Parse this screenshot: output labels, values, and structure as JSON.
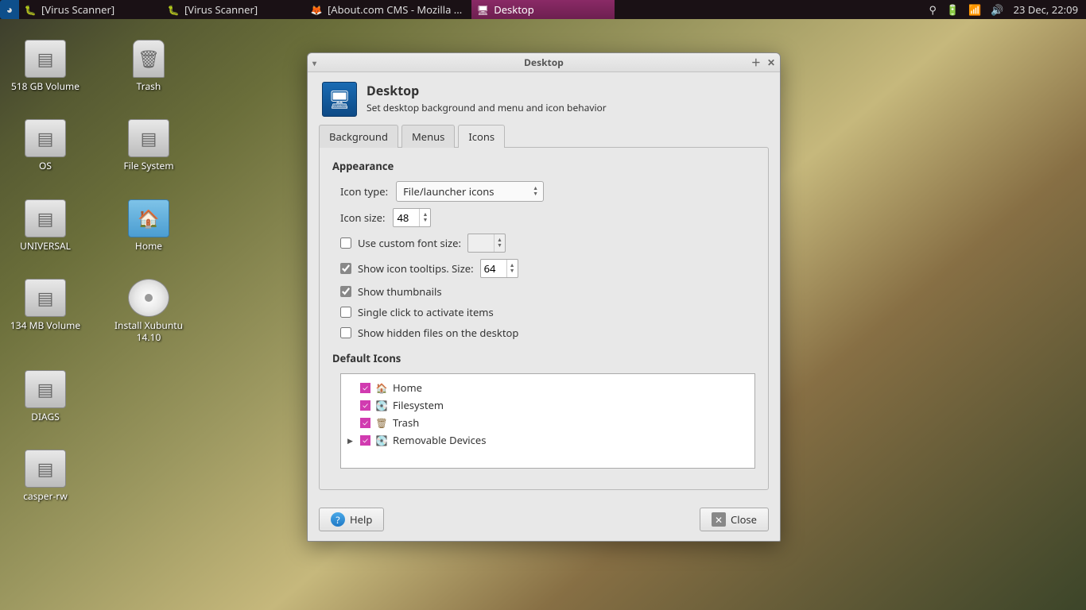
{
  "panel": {
    "tasks": [
      {
        "label": "[Virus Scanner]",
        "icon": "🐛"
      },
      {
        "label": "[Virus Scanner]",
        "icon": "🐛"
      },
      {
        "label": "[About.com CMS - Mozilla ...",
        "icon": "🦊"
      },
      {
        "label": "Desktop",
        "icon": "🖥",
        "active": true
      }
    ],
    "clock": "23 Dec, 22:09"
  },
  "desktop_icons": [
    [
      {
        "label": "518 GB Volume",
        "kind": "drive"
      },
      {
        "label": "Trash",
        "kind": "trash"
      }
    ],
    [
      {
        "label": "OS",
        "kind": "drive"
      },
      {
        "label": "File System",
        "kind": "drive"
      }
    ],
    [
      {
        "label": "UNIVERSAL",
        "kind": "drive"
      },
      {
        "label": "Home",
        "kind": "folder"
      }
    ],
    [
      {
        "label": "134 MB Volume",
        "kind": "drive"
      },
      {
        "label": "Install Xubuntu 14.10",
        "kind": "cd"
      }
    ],
    [
      {
        "label": "DIAGS",
        "kind": "drive"
      }
    ],
    [
      {
        "label": "casper-rw",
        "kind": "drive"
      }
    ]
  ],
  "window": {
    "title": "Desktop",
    "header_title": "Desktop",
    "header_subtitle": "Set desktop background and menu and icon behavior",
    "tabs": {
      "background": "Background",
      "menus": "Menus",
      "icons": "Icons"
    },
    "appearance": {
      "title": "Appearance",
      "icon_type_label": "Icon type:",
      "icon_type_value": "File/launcher icons",
      "icon_size_label": "Icon size:",
      "icon_size_value": "48",
      "custom_font_label": "Use custom font size:",
      "custom_font_checked": false,
      "custom_font_value": "",
      "tooltips_label": "Show icon tooltips. Size:",
      "tooltips_checked": true,
      "tooltips_value": "64",
      "thumbnails_label": "Show thumbnails",
      "thumbnails_checked": true,
      "singleclick_label": "Single click to activate items",
      "singleclick_checked": false,
      "hidden_label": "Show hidden files on the desktop",
      "hidden_checked": false
    },
    "default_icons": {
      "title": "Default Icons",
      "items": [
        {
          "label": "Home",
          "icon": "🏠"
        },
        {
          "label": "Filesystem",
          "icon": "💽"
        },
        {
          "label": "Trash",
          "icon": "🗑"
        },
        {
          "label": "Removable Devices",
          "icon": "💽",
          "expandable": true
        }
      ]
    },
    "buttons": {
      "help": "Help",
      "close": "Close"
    }
  }
}
